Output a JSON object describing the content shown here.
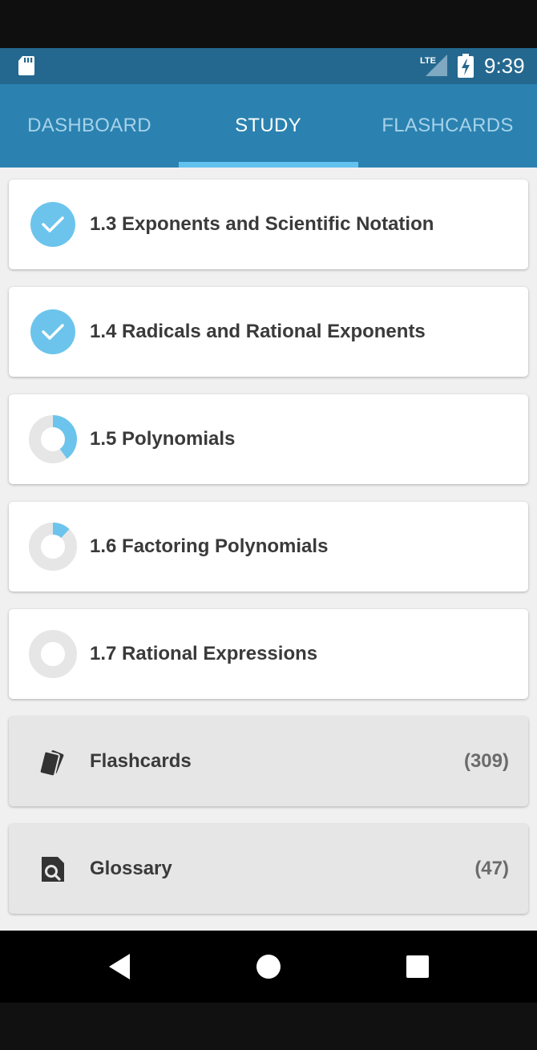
{
  "status_bar": {
    "time": "9:39",
    "network": "LTE",
    "icons": [
      "sd-card-icon",
      "lte-signal-icon",
      "battery-charging-icon"
    ]
  },
  "tabs": [
    {
      "label": "DASHBOARD",
      "active": false
    },
    {
      "label": "STUDY",
      "active": true
    },
    {
      "label": "FLASHCARDS",
      "active": false
    }
  ],
  "sections": [
    {
      "label": "1.3 Exponents and Scientific Notation",
      "status": "complete",
      "progress": 1.0
    },
    {
      "label": "1.4 Radicals and Rational Exponents",
      "status": "complete",
      "progress": 1.0
    },
    {
      "label": "1.5 Polynomials",
      "status": "in-progress",
      "progress": 0.4
    },
    {
      "label": "1.6 Factoring Polynomials",
      "status": "in-progress",
      "progress": 0.12
    },
    {
      "label": "1.7 Rational Expressions",
      "status": "not-started",
      "progress": 0.0
    }
  ],
  "resources": [
    {
      "label": "Flashcards",
      "count": "(309)",
      "icon": "flashcards-icon"
    },
    {
      "label": "Glossary",
      "count": "(47)",
      "icon": "glossary-search-icon"
    }
  ],
  "colors": {
    "status_bar": "#24688f",
    "tab_bar": "#2b82b0",
    "tab_indicator": "#63c1ee",
    "progress_fill": "#6cc4ec",
    "progress_track": "#e6e6e6"
  },
  "nav_bar": {
    "icons": [
      "back-icon",
      "home-icon",
      "recent-apps-icon"
    ]
  }
}
